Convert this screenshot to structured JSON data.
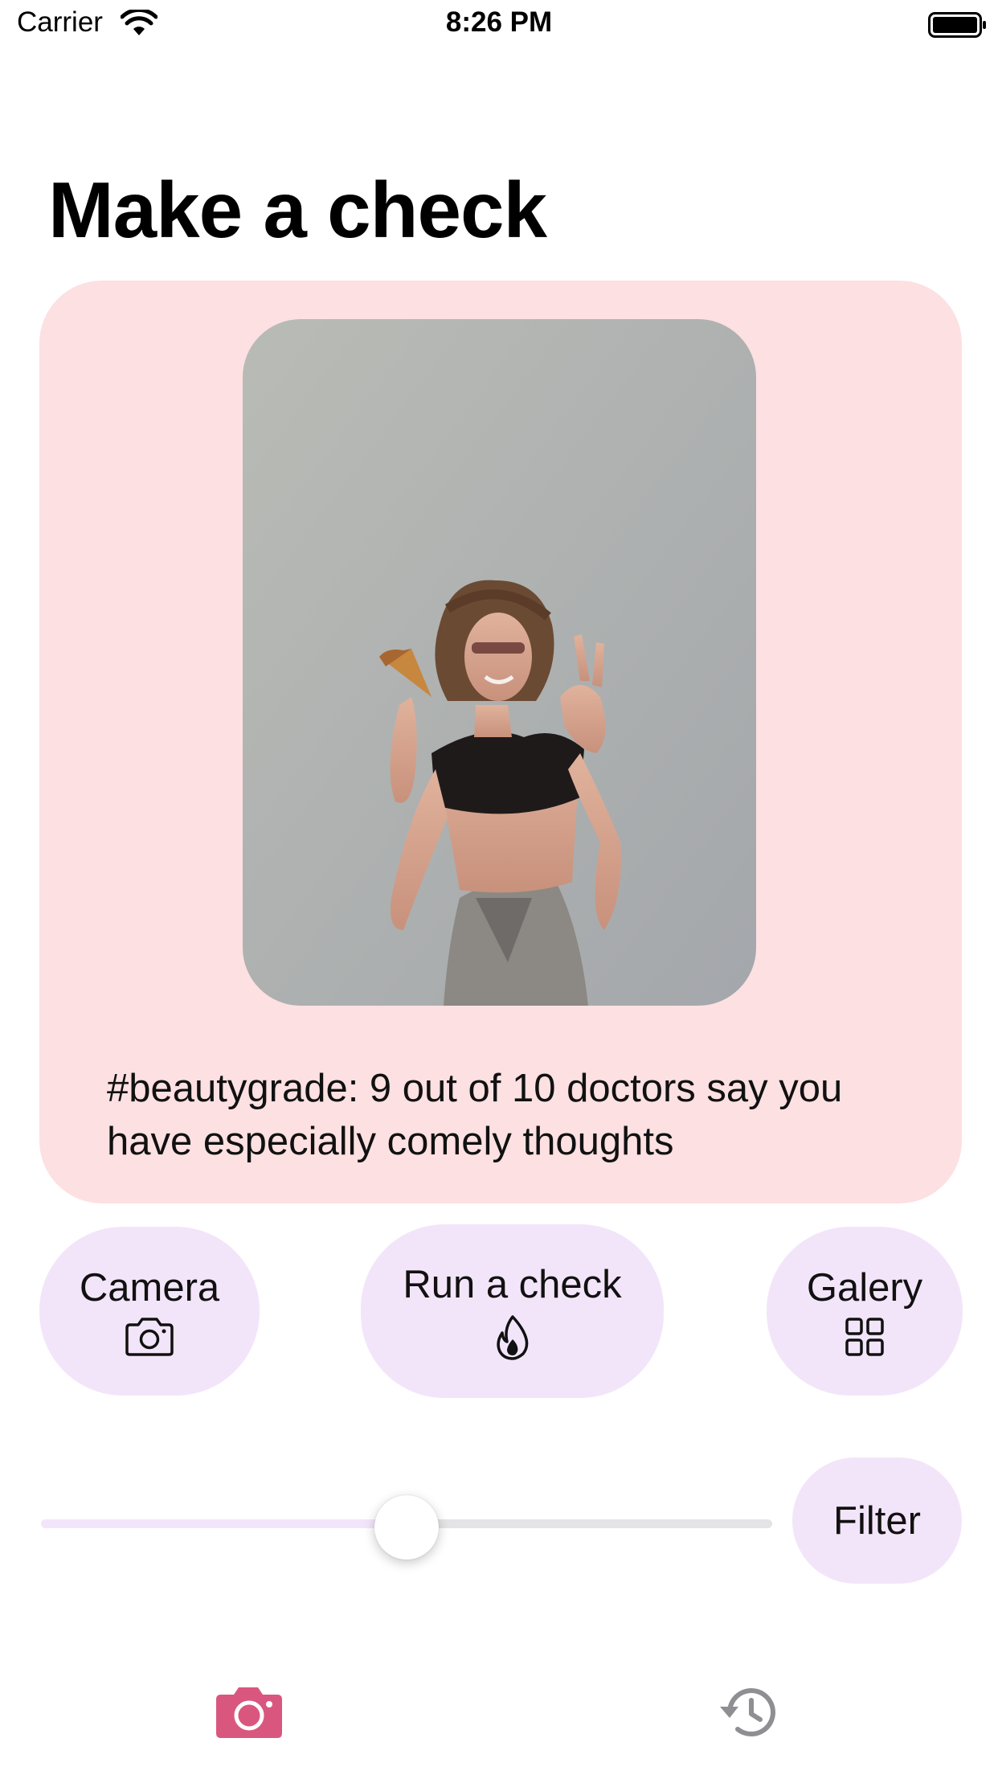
{
  "status_bar": {
    "carrier": "Carrier",
    "time": "8:26 PM",
    "icons": [
      "wifi-icon",
      "battery-icon"
    ]
  },
  "page": {
    "title": "Make a check"
  },
  "result_card": {
    "background_color": "#fde0e2",
    "caption": "#beautygrade: 9 out of 10 doctors say you have especially comely thoughts"
  },
  "actions": {
    "camera": {
      "label": "Camera",
      "icon": "camera-icon"
    },
    "run_check": {
      "label": "Run a check",
      "icon": "flame-icon"
    },
    "gallery": {
      "label": "Galery",
      "icon": "grid-icon"
    }
  },
  "filter": {
    "slider_value": 0.5,
    "button_label": "Filter"
  },
  "tab_bar": {
    "items": [
      {
        "icon": "camera-icon",
        "selected": true,
        "color": "#d9577f"
      },
      {
        "icon": "history-icon",
        "selected": false,
        "color": "#8e8e93"
      }
    ]
  },
  "colors": {
    "button_background": "#f3e5f9",
    "accent": "#d9577f"
  }
}
